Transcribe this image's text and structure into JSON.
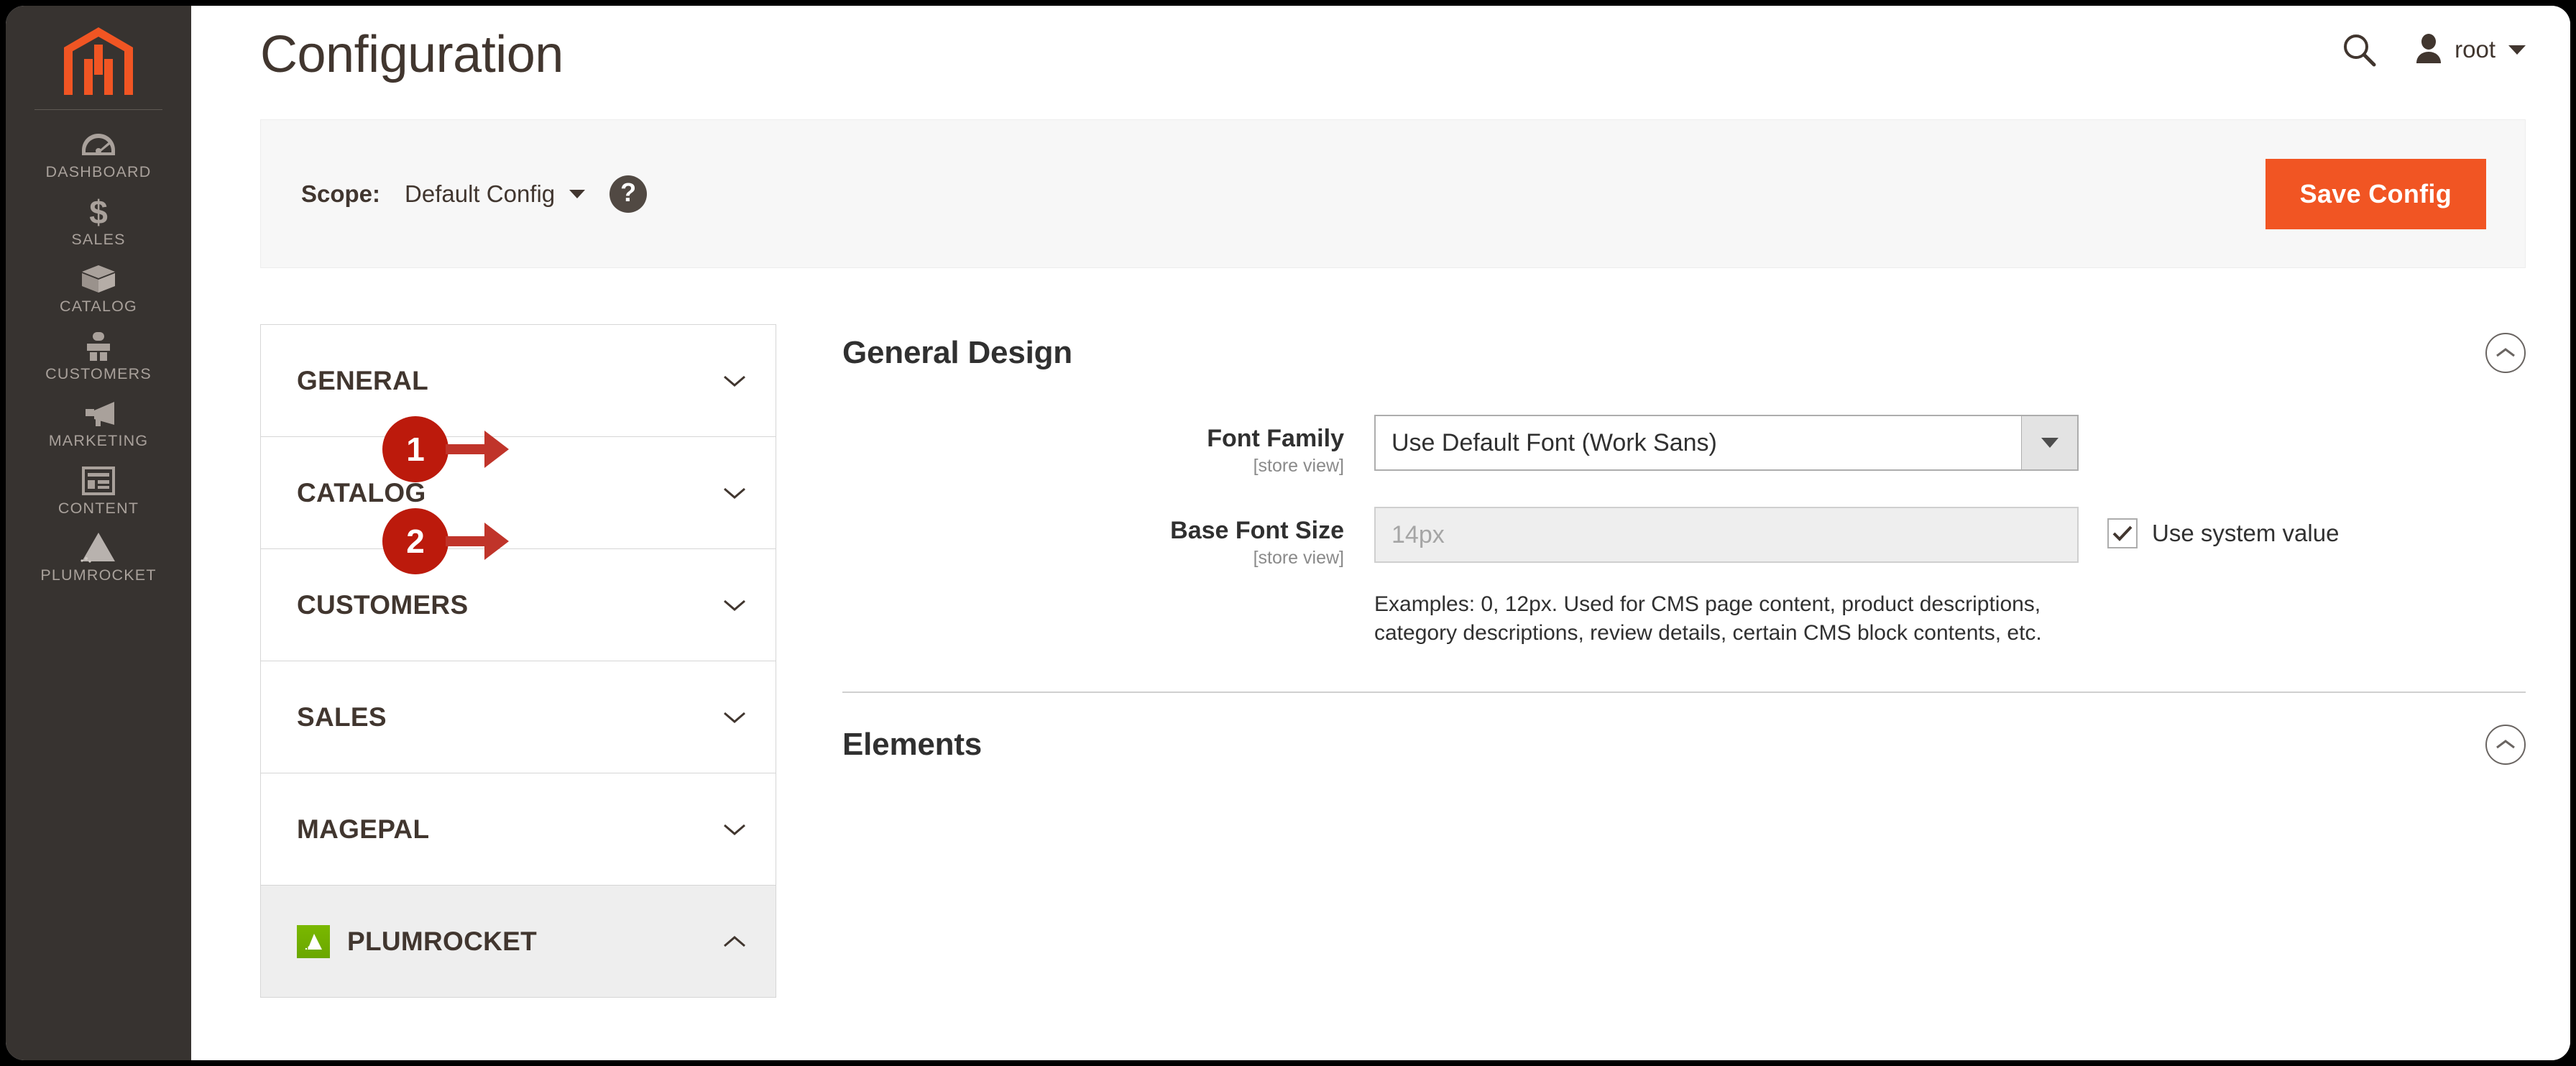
{
  "sidebar": {
    "logo_name": "magento-logo",
    "items": [
      {
        "label": "DASHBOARD",
        "icon": "dashboard-icon"
      },
      {
        "label": "SALES",
        "icon": "dollar-icon"
      },
      {
        "label": "CATALOG",
        "icon": "box-icon"
      },
      {
        "label": "CUSTOMERS",
        "icon": "person-icon"
      },
      {
        "label": "MARKETING",
        "icon": "megaphone-icon"
      },
      {
        "label": "CONTENT",
        "icon": "layout-icon"
      },
      {
        "label": "PLUMROCKET",
        "icon": "plumrocket-icon"
      }
    ]
  },
  "header": {
    "title": "Configuration",
    "search_icon": "search-icon",
    "user_icon": "user-avatar-icon",
    "user_name": "root",
    "caret_icon": "chevron-down-icon"
  },
  "scope_bar": {
    "label": "Scope:",
    "value": "Default Config",
    "help_glyph": "?",
    "save_label": "Save Config"
  },
  "config_nav": {
    "items": [
      {
        "label": "GENERAL",
        "expanded": false,
        "has_badge": false
      },
      {
        "label": "CATALOG",
        "expanded": false,
        "has_badge": false
      },
      {
        "label": "CUSTOMERS",
        "expanded": false,
        "has_badge": false
      },
      {
        "label": "SALES",
        "expanded": false,
        "has_badge": false
      },
      {
        "label": "MAGEPAL",
        "expanded": false,
        "has_badge": false
      },
      {
        "label": "PLUMROCKET",
        "expanded": true,
        "has_badge": true
      }
    ]
  },
  "main": {
    "sections": [
      {
        "title": "General Design",
        "collapsed": false
      },
      {
        "title": "Elements",
        "collapsed": false
      }
    ],
    "fields": {
      "font_family": {
        "annotation": "1",
        "label": "Font Family",
        "scope": "[store view]",
        "value": "Use Default Font (Work Sans)"
      },
      "base_font_size": {
        "annotation": "2",
        "label": "Base Font Size",
        "scope": "[store view]",
        "value": "",
        "placeholder": "14px",
        "system_value_label": "Use system value",
        "system_value_checked": true,
        "note": "Examples: 0, 12px. Used for CMS page content, product descriptions, category descriptions, review details, certain CMS block contents, etc."
      }
    }
  },
  "colors": {
    "accent_orange": "#f15523",
    "sidebar_bg": "#373330",
    "annotation_red": "#bc1a0c",
    "plumrocket_green": "#7ab800",
    "text_dark": "#303030"
  }
}
